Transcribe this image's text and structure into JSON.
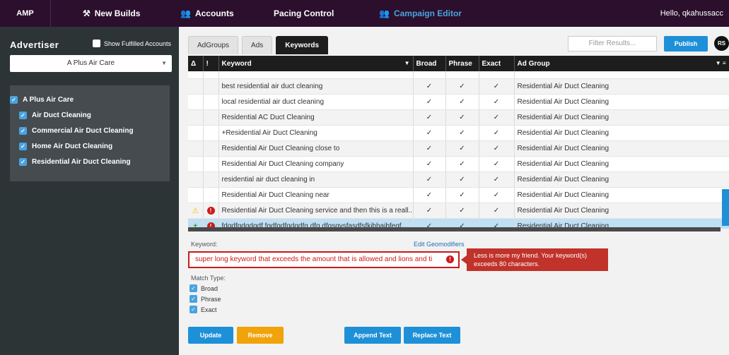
{
  "nav": {
    "brand": "AMP",
    "items": [
      {
        "label": "New Builds",
        "icon": "tools-icon"
      },
      {
        "label": "Accounts",
        "icon": "users-icon"
      },
      {
        "label": "Pacing Control"
      },
      {
        "label": "Campaign Editor",
        "icon": "users-icon"
      }
    ],
    "greeting": "Hello, qkahussacc"
  },
  "sidebar": {
    "heading": "Advertiser",
    "show_fulfilled": "Show Fulfilled Accounts",
    "selected_advertiser": "A Plus Air Care",
    "tree": [
      {
        "label": "A Plus Air Care",
        "level": 0
      },
      {
        "label": "Air Duct Cleaning",
        "level": 1
      },
      {
        "label": "Commercial Air Duct Cleaning",
        "level": 1
      },
      {
        "label": "Home Air Duct Cleaning",
        "level": 1
      },
      {
        "label": "Residential Air Duct Cleaning",
        "level": 1
      }
    ]
  },
  "tabs": [
    "AdGroups",
    "Ads",
    "Keywords"
  ],
  "filter_placeholder": "Filter Results...",
  "publish_label": "Publish",
  "avatar_initials": "RS",
  "table": {
    "headers": [
      "Δ",
      "!",
      "Keyword",
      "Broad",
      "Phrase",
      "Exact",
      "Ad Group"
    ],
    "rows": [
      {
        "keyword": "best residential air duct cleaning",
        "group": "Residential Air Duct Cleaning"
      },
      {
        "keyword": "local residential air duct cleaning",
        "group": "Residential Air Duct Cleaning"
      },
      {
        "keyword": "Residential AC Duct Cleaning",
        "group": "Residential Air Duct Cleaning"
      },
      {
        "keyword": "+Residential Air Duct Cleaning",
        "group": "Residential Air Duct Cleaning"
      },
      {
        "keyword": "Residential Air Duct Cleaning close to",
        "group": "Residential Air Duct Cleaning"
      },
      {
        "keyword": "Residential Air Duct Cleaning company",
        "group": "Residential Air Duct Cleaning"
      },
      {
        "keyword": "residential air duct cleaning in",
        "group": "Residential Air Duct Cleaning"
      },
      {
        "keyword": "Residential Air Duct Cleaning near",
        "group": "Residential Air Duct Cleaning"
      },
      {
        "keyword": "Residential Air Duct Cleaning service and then this is a reall...",
        "group": "Residential Air Duct Cleaning",
        "warn": "⚠",
        "err": "!"
      },
      {
        "keyword": "fdgdfgdgdgdf fgdfgdfgdgdfg dfg dfgsgvsfasdfsfkjbhajbfegf...",
        "group": "Residential Air Duct Cleaning",
        "flag": "+",
        "err": "!"
      }
    ],
    "check": "✓"
  },
  "editor": {
    "keyword_label": "Keyword:",
    "geo_link": "Edit Geomodifiers",
    "keyword_value": "super long keyword that exceeds the amount that is allowed and lions and ti",
    "error_text": "Less is more my friend. Your keyword(s) exceeds 80 characters.",
    "match_type_label": "Match Type:",
    "match_types": [
      "Broad",
      "Phrase",
      "Exact"
    ],
    "buttons": {
      "update": "Update",
      "remove": "Remove",
      "append": "Append Text",
      "replace": "Replace Text"
    },
    "colors": {
      "update": "#1e90d8",
      "remove": "#f0a30a",
      "append": "#1e90d8",
      "replace": "#1e90d8"
    }
  }
}
